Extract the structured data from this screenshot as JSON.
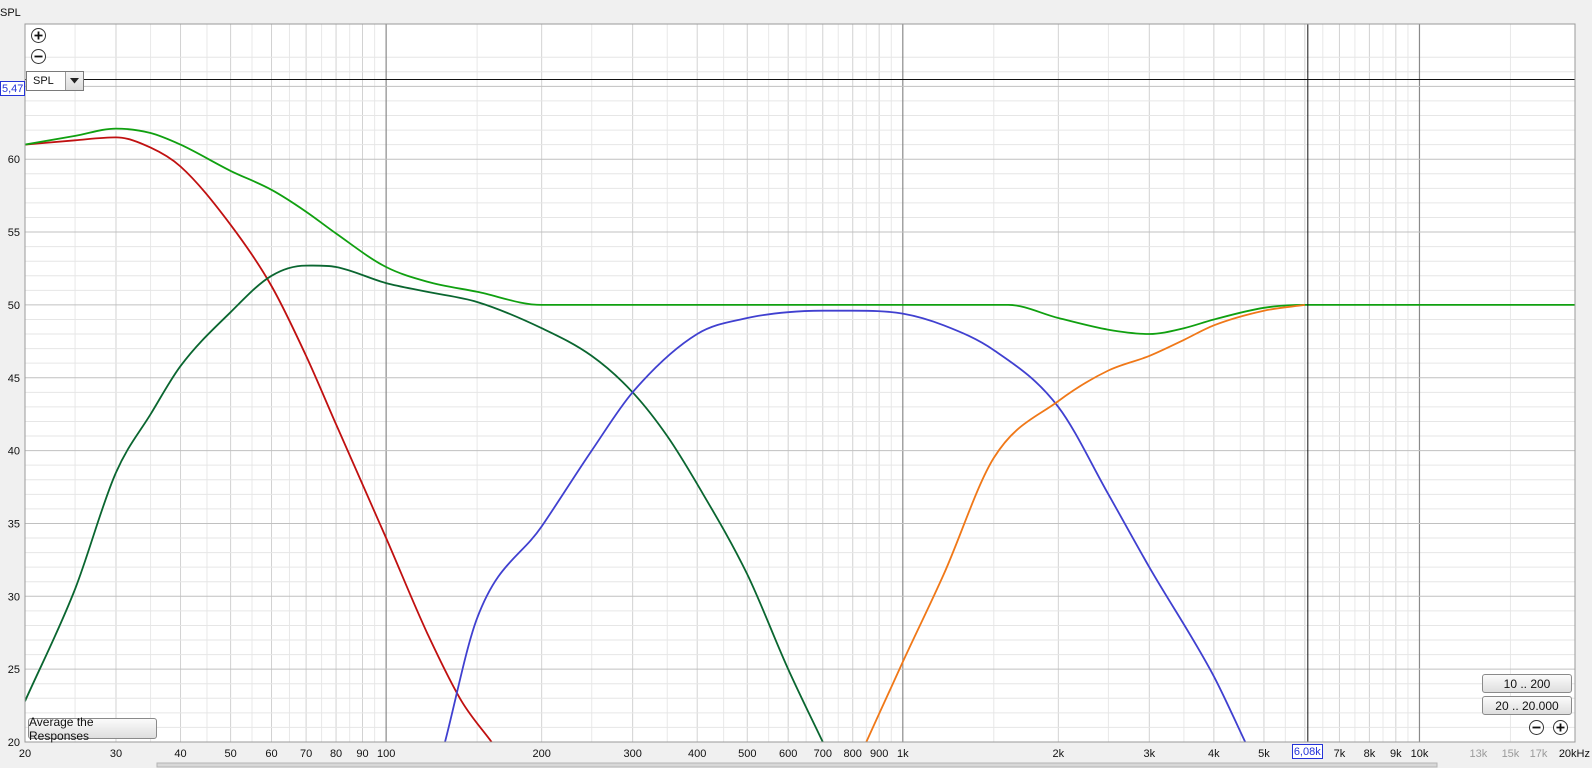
{
  "axis": {
    "y_label": "SPL",
    "x_unit_label": "20kHz"
  },
  "cursor": {
    "y_value_label": "5,47",
    "x_value_label": "6,08k",
    "x_value": 6080,
    "y_value": 65.47
  },
  "controls": {
    "spl_select_value": "SPL",
    "average_button_label": "Average the Responses",
    "range_button_1": "10 .. 200",
    "range_button_2": "20 .. 20.000",
    "zoom_in_icon": "zoom-in-icon",
    "zoom_out_icon": "zoom-out-icon"
  },
  "chart_data": {
    "type": "line",
    "title": "",
    "xlabel": "",
    "ylabel": "SPL",
    "x_scale": "log",
    "xlim": [
      20,
      20000
    ],
    "ylim": [
      20,
      67
    ],
    "grid": true,
    "legend": "none",
    "y_ticks": [
      20,
      25,
      30,
      35,
      40,
      45,
      50,
      55,
      60,
      65
    ],
    "y_tick_labels": [
      "20",
      "25",
      "30",
      "35",
      "40",
      "45",
      "50",
      "55",
      "60",
      "65"
    ],
    "x_ticks": [
      20,
      30,
      40,
      50,
      60,
      70,
      80,
      90,
      100,
      200,
      300,
      400,
      500,
      600,
      700,
      800,
      900,
      1000,
      2000,
      3000,
      4000,
      5000,
      7000,
      8000,
      9000,
      10000,
      13000,
      15000,
      17000
    ],
    "x_tick_labels": [
      "20",
      "30",
      "40",
      "50",
      "60",
      "70",
      "80",
      "90",
      "100",
      "200",
      "300",
      "400",
      "500",
      "600",
      "700",
      "800",
      "900",
      "1k",
      "2k",
      "3k",
      "4k",
      "5k",
      "7k",
      "8k",
      "9k",
      "10k",
      "13k",
      "15k",
      "17k"
    ],
    "x_tick_dim": [
      false,
      false,
      false,
      false,
      false,
      false,
      false,
      false,
      false,
      false,
      false,
      false,
      false,
      false,
      false,
      false,
      false,
      false,
      false,
      false,
      false,
      false,
      false,
      false,
      false,
      false,
      true,
      true,
      true
    ],
    "series": [
      {
        "color": "#c01010",
        "x": [
          20,
          25,
          30,
          35,
          40,
          50,
          60,
          70,
          80,
          100,
          120,
          140,
          160
        ],
        "y": [
          61.0,
          61.3,
          61.5,
          60.8,
          59.5,
          55.5,
          51.3,
          46.5,
          41.8,
          34.0,
          27.5,
          22.8,
          20.0
        ]
      },
      {
        "color": "#10a010",
        "x": [
          20,
          25,
          30,
          35,
          40,
          50,
          60,
          70,
          80,
          100,
          120,
          150,
          200,
          250,
          300,
          500,
          1000,
          1600,
          2000,
          2500,
          3000,
          3500,
          4000,
          5000,
          6000,
          8000,
          10000,
          20000
        ],
        "y": [
          61.0,
          61.6,
          62.1,
          61.8,
          61.0,
          59.2,
          57.9,
          56.4,
          54.9,
          52.6,
          51.6,
          50.9,
          50.0,
          50.0,
          50.0,
          50.0,
          50.0,
          50.0,
          49.1,
          48.3,
          48.0,
          48.4,
          49.0,
          49.8,
          50.0,
          50.0,
          50.0,
          50.0
        ]
      },
      {
        "color": "#0a6630",
        "x": [
          20,
          25,
          30,
          35,
          40,
          50,
          60,
          70,
          80,
          100,
          120,
          150,
          200,
          250,
          300,
          350,
          400,
          500,
          600,
          700
        ],
        "y": [
          22.8,
          30.5,
          38.5,
          42.5,
          45.8,
          49.5,
          52.0,
          52.7,
          52.6,
          51.5,
          50.9,
          50.2,
          48.4,
          46.5,
          44.0,
          41.0,
          37.7,
          31.5,
          25.0,
          20.0
        ]
      },
      {
        "color": "#4040d0",
        "x": [
          130,
          150,
          200,
          250,
          300,
          400,
          500,
          600,
          700,
          800,
          1000,
          1200,
          1500,
          2000,
          2500,
          3000,
          4000,
          4600
        ],
        "y": [
          20.0,
          28.5,
          34.8,
          40.0,
          44.0,
          48.0,
          49.1,
          49.5,
          49.6,
          49.6,
          49.4,
          48.6,
          46.9,
          43.0,
          37.0,
          32.0,
          24.5,
          20.0
        ]
      },
      {
        "color": "#f07818",
        "x": [
          850,
          1000,
          1200,
          1500,
          2000,
          2500,
          3000,
          3500,
          4000,
          5000,
          6000
        ],
        "y": [
          20.0,
          25.5,
          31.5,
          39.5,
          43.4,
          45.5,
          46.5,
          47.6,
          48.6,
          49.6,
          50.0
        ]
      }
    ]
  }
}
